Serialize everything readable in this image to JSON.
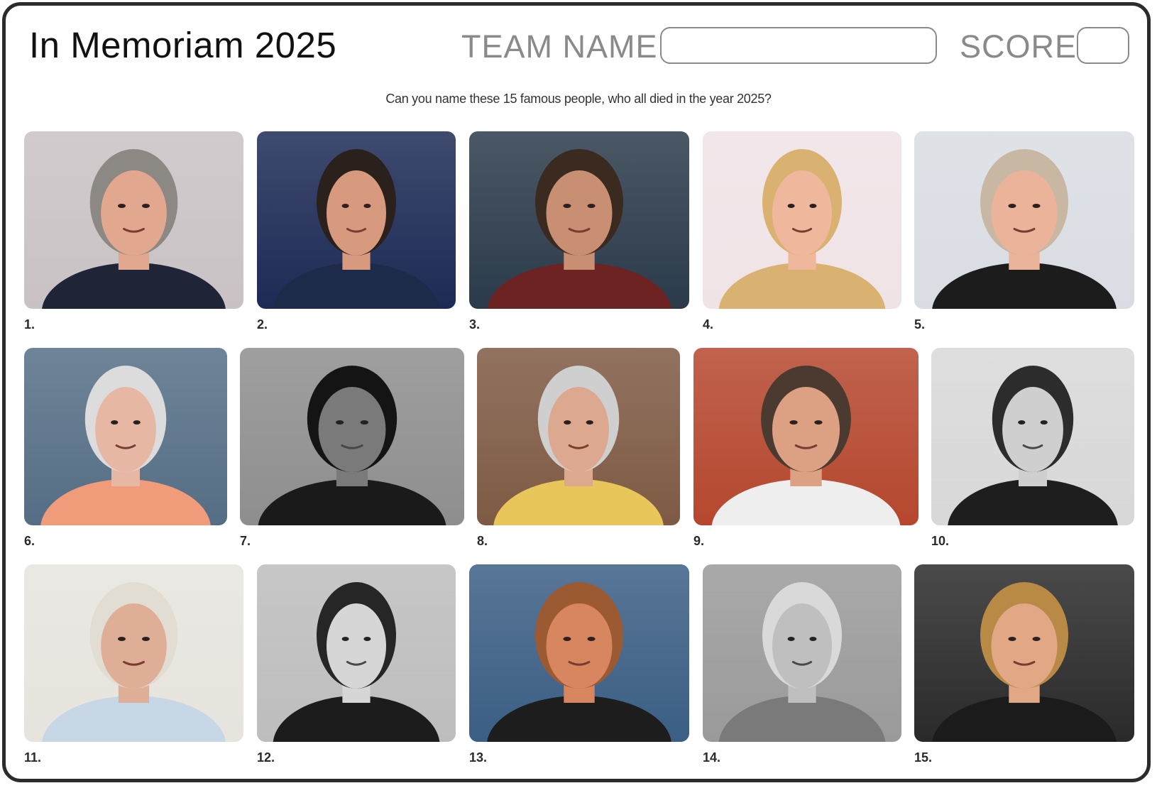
{
  "header": {
    "title": "In Memoriam 2025",
    "team_label": "TEAM NAME",
    "team_value": "",
    "score_label": "SCORE",
    "score_value": ""
  },
  "subtitle": "Can you name these 15 famous people, who all died in the year 2025?",
  "photos": [
    {
      "number": "1.",
      "tone": "color",
      "bg": "#c9c2c4",
      "skin": "#e2a78f",
      "hair": "#8c8884",
      "clothes": "#1f2436"
    },
    {
      "number": "2.",
      "tone": "color",
      "bg": "#1d2a55",
      "skin": "#d79a7e",
      "hair": "#2a211c",
      "clothes": "#1e2a4a"
    },
    {
      "number": "3.",
      "tone": "color",
      "bg": "#2b3a4a",
      "skin": "#c88f73",
      "hair": "#3a2a1f",
      "clothes": "#6e2323"
    },
    {
      "number": "4.",
      "tone": "color",
      "bg": "#efe3e6",
      "skin": "#efb79c",
      "hair": "#d9b271",
      "clothes": "#d9b271"
    },
    {
      "number": "5.",
      "tone": "color",
      "bg": "#d9dde3",
      "skin": "#eab39a",
      "hair": "#c8b8a3",
      "clothes": "#1c1c1c"
    },
    {
      "number": "6.",
      "tone": "color",
      "bg": "#556e85",
      "skin": "#e6b8a4",
      "hair": "#dcdcdc",
      "clothes": "#f09b79"
    },
    {
      "number": "7.",
      "tone": "mono",
      "bg": "#8e8e8e",
      "skin": "#7a7a7a",
      "hair": "#141414",
      "clothes": "#1a1a1a"
    },
    {
      "number": "8.",
      "tone": "color",
      "bg": "#7e5a44",
      "skin": "#dca88f",
      "hair": "#cfcfcf",
      "clothes": "#e8c65a"
    },
    {
      "number": "9.",
      "tone": "color",
      "bg": "#b5472e",
      "skin": "#dca083",
      "hair": "#4b3a2f",
      "clothes": "#eeeeee"
    },
    {
      "number": "10.",
      "tone": "mono",
      "bg": "#d8d8d8",
      "skin": "#cfcfcf",
      "hair": "#2c2c2c",
      "clothes": "#1e1e1e"
    },
    {
      "number": "11.",
      "tone": "color",
      "bg": "#e6e4dd",
      "skin": "#dfae97",
      "hair": "#e2ddd2",
      "clothes": "#c7d7e6"
    },
    {
      "number": "12.",
      "tone": "mono",
      "bg": "#bdbdbd",
      "skin": "#d6d6d6",
      "hair": "#262626",
      "clothes": "#1c1c1c"
    },
    {
      "number": "13.",
      "tone": "color",
      "bg": "#3b5e84",
      "skin": "#d7865f",
      "hair": "#9c5a33",
      "clothes": "#1d1d1d"
    },
    {
      "number": "14.",
      "tone": "mono",
      "bg": "#9a9a9a",
      "skin": "#bfbfbf",
      "hair": "#d9d9d9",
      "clothes": "#7a7a7a"
    },
    {
      "number": "15.",
      "tone": "color",
      "bg": "#2a2a2a",
      "skin": "#e2a784",
      "hair": "#b98a46",
      "clothes": "#1b1b1b"
    }
  ]
}
